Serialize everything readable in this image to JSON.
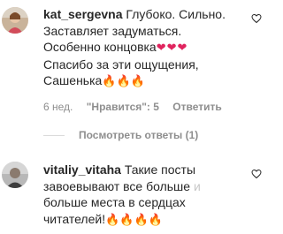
{
  "comments": [
    {
      "username": "kat_sergevna",
      "text_lines": [
        "Глубоко. Сильно.",
        "Заставляет задуматься.",
        "Особенно концовка",
        "Спасибо за эти ощущения,",
        "Сашенька"
      ],
      "emoji_hearts": "❤❤❤",
      "emoji_fire": "🔥🔥🔥",
      "time": "6 нед.",
      "likes": "\"Нравится\": 5",
      "reply": "Ответить",
      "replies_toggle": "Посмотреть ответы (1)"
    },
    {
      "username": "vitaliy_vitaha",
      "text_first": "Такие посты",
      "text_lines": [
        "завоевывают все больше",
        "больше места в сердцах",
        "читателей!"
      ],
      "faded_char": "и",
      "emoji_fire": "🔥🔥🔥🔥"
    }
  ],
  "colors": {
    "text": "#262626",
    "muted": "#8e8e8e",
    "heart": "#e0245e",
    "fire": "#f08a24"
  },
  "icons": [
    "heart-outline-icon",
    "heart-outline-icon"
  ]
}
